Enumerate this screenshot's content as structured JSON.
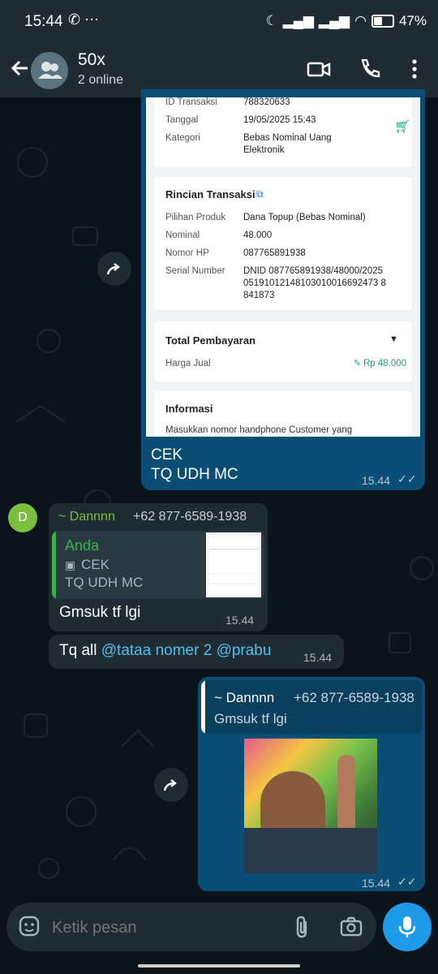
{
  "status": {
    "time": "15:44",
    "battery": "47%"
  },
  "header": {
    "title": "50x",
    "subtitle": "2 online"
  },
  "receipt": {
    "id_label": "ID Transaksi",
    "id_value": "788320633",
    "date_label": "Tanggal",
    "date_value": "19/05/2025 15:43",
    "cat_label": "Kategori",
    "cat_value_line1": "Bebas Nominal Uang",
    "cat_value_line2": "Elektronik",
    "detail_title": "Rincian Transaksi",
    "product_label": "Pilihan Produk",
    "product_value": "Dana Topup (Bebas Nominal)",
    "nominal_label": "Nominal",
    "nominal_value": "48.000",
    "hp_label": "Nomor HP",
    "hp_value": "087765891938",
    "serial_label": "Serial Number",
    "serial_line1": "DNID 087765891938/48000/2025",
    "serial_line2": "05191012148103010016692473 8",
    "serial_line3": "841873",
    "total_title": "Total Pembayaran",
    "price_label": "Harga Jual",
    "price_value": "Rp 48.000",
    "info_title": "Informasi",
    "info_text": "Masukkan nomor handphone Customer yang"
  },
  "msg1": {
    "line1": "CEK",
    "line2": "TQ UDH MC",
    "time": "15.44"
  },
  "msg2": {
    "avatar_letter": "D",
    "sender": "~ Dannnn",
    "phone": "+62 877-6589-1938",
    "quote_author": "Anda",
    "quote_line1": "CEK",
    "quote_line2": "TQ UDH MC",
    "text": "Gmsuk tf lgi",
    "time": "15.44"
  },
  "msg3": {
    "text": "Tq all ",
    "mention1": "@tataa nomer 2",
    "mention2": "@prabu",
    "time": "15.44"
  },
  "msg4": {
    "quote_sender": "~ Dannnn",
    "quote_phone": "+62 877-6589-1938",
    "quote_text": "Gmsuk tf lgi",
    "time": "15.44"
  },
  "input": {
    "placeholder": "Ketik pesan"
  },
  "colors": {
    "bubble_out": "#0b4e75",
    "bubble_in": "#1f2c34",
    "mention": "#53bdeb",
    "accent_green": "#7bbf3f"
  }
}
